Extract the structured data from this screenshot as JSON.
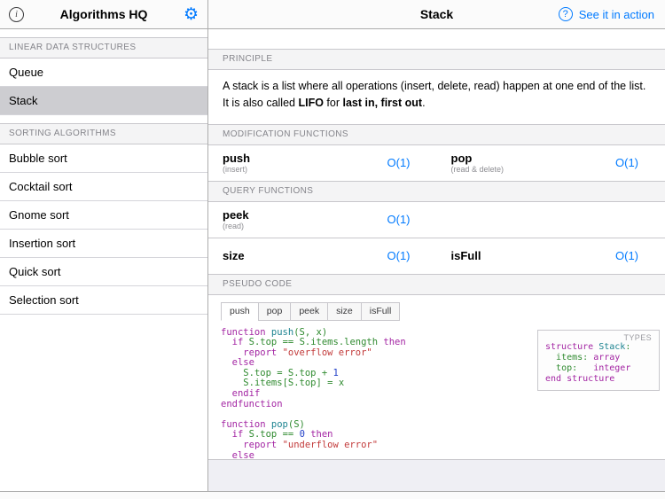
{
  "accent_color": "#007AFF",
  "icons": {
    "info": "i",
    "settings": "⚙",
    "help": "?"
  },
  "sidebar": {
    "title": "Algorithms HQ",
    "selected_item": "Stack",
    "sections": [
      {
        "header": "LINEAR DATA STRUCTURES",
        "items": [
          {
            "label": "Queue"
          },
          {
            "label": "Stack"
          }
        ]
      },
      {
        "header": "SORTING ALGORITHMS",
        "items": [
          {
            "label": "Bubble sort"
          },
          {
            "label": "Cocktail sort"
          },
          {
            "label": "Gnome sort"
          },
          {
            "label": "Insertion sort"
          },
          {
            "label": "Quick sort"
          },
          {
            "label": "Selection sort"
          }
        ]
      }
    ]
  },
  "content": {
    "nav": {
      "title": "Stack",
      "action_link": "See it in action"
    },
    "sections": {
      "principle": {
        "header": "PRINCIPLE",
        "parts": [
          {
            "text": "A stack is a list where all operations (insert, delete, read) happen at one end of the list. It is also called ",
            "bold": false
          },
          {
            "text": "LIFO",
            "bold": true
          },
          {
            "text": " for ",
            "bold": false
          },
          {
            "text": "last in, first out",
            "bold": true
          },
          {
            "text": ".",
            "bold": false
          }
        ]
      },
      "modification": {
        "header": "MODIFICATION FUNCTIONS",
        "rows": [
          [
            {
              "name": "push",
              "note": "(insert)",
              "complexity": "O(1)"
            },
            {
              "name": "pop",
              "note": "(read & delete)",
              "complexity": "O(1)"
            }
          ]
        ]
      },
      "query": {
        "header": "QUERY FUNCTIONS",
        "rows": [
          [
            {
              "name": "peek",
              "note": "(read)",
              "complexity": "O(1)"
            },
            null
          ],
          [
            {
              "name": "size",
              "note": "",
              "complexity": "O(1)"
            },
            {
              "name": "isFull",
              "note": "",
              "complexity": "O(1)"
            }
          ]
        ]
      },
      "pseudocode": {
        "header": "PSEUDO CODE",
        "tabs": [
          "push",
          "pop",
          "peek",
          "size",
          "isFull"
        ],
        "active_tab": "push",
        "code_lines": [
          "function push(S, x)",
          "  if S.top == S.items.length then",
          "    report \"overflow error\"",
          "  else",
          "    S.top = S.top + 1",
          "    S.items[S.top] = x",
          "  endif",
          "endfunction",
          "",
          "function pop(S)",
          "  if S.top == 0 then",
          "    report \"underflow error\"",
          "  else"
        ],
        "types_box": {
          "label": "TYPES",
          "lines": [
            "structure Stack:",
            "  items: array",
            "  top:   integer",
            "end structure"
          ]
        }
      }
    }
  },
  "syntax_colors": {
    "keyword": "#A325A3",
    "plain": "#2F8A2F",
    "string": "#C23A3A",
    "number": "#2240C8",
    "name": "#1C8390"
  }
}
